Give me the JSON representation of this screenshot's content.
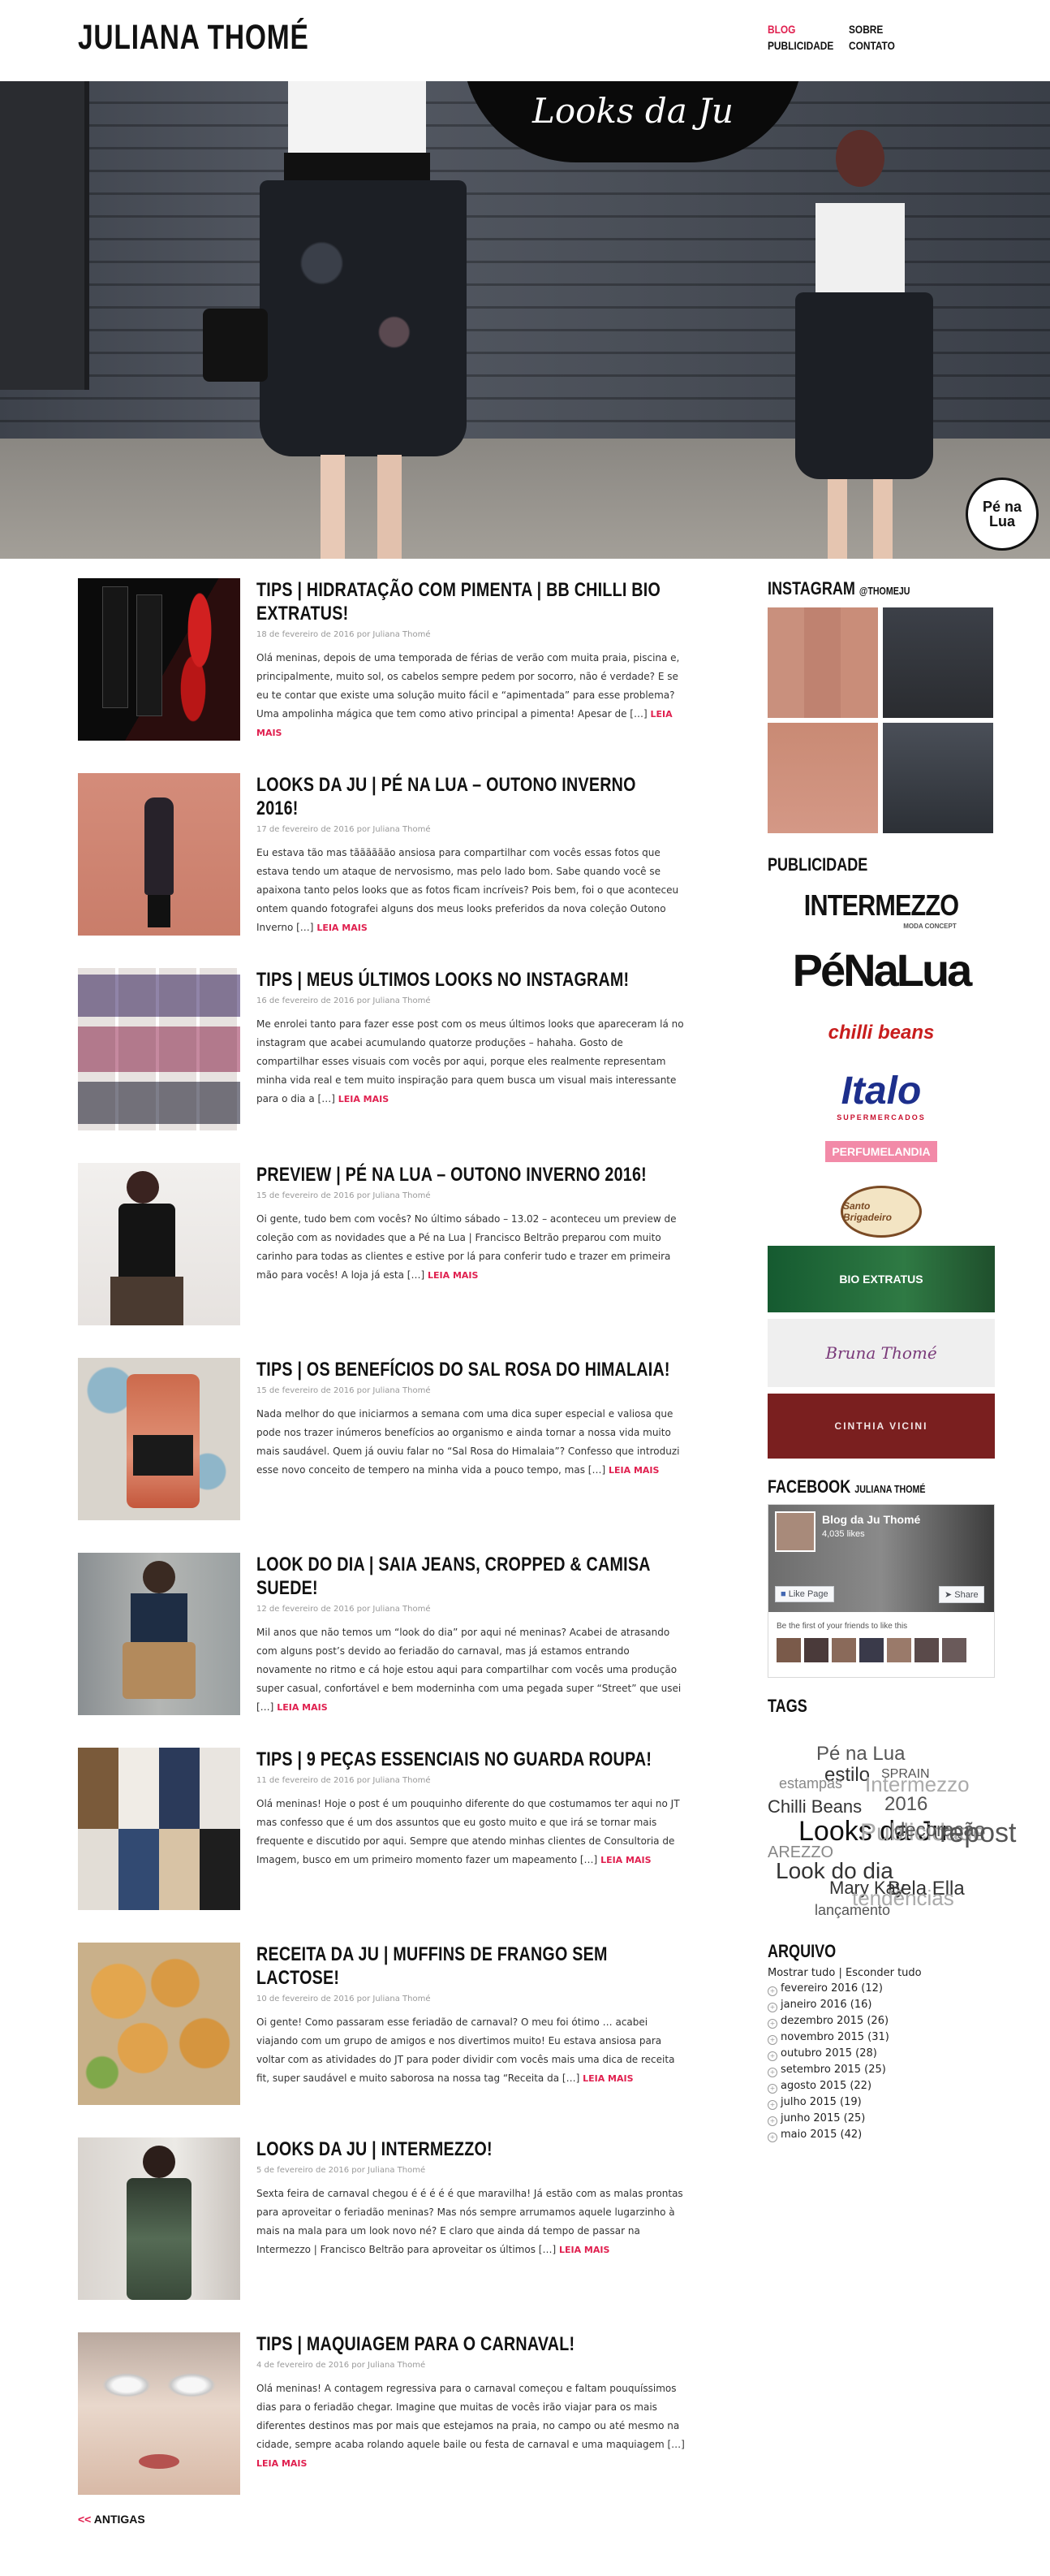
{
  "header": {
    "logo": "JULIANA THOMÉ",
    "nav": [
      "BLOG",
      "SOBRE",
      "PUBLICIDADE",
      "CONTATO"
    ]
  },
  "hero": {
    "badge": "Looks da Ju",
    "stamp": "Pé na Lua"
  },
  "posts": [
    {
      "title": "TIPS | HIDRATAÇÃO COM PIMENTA | BB CHILLI BIO EXTRATUS!",
      "date": "18 de fevereiro de 2016 por Juliana Thomé",
      "excerpt": "Olá meninas, depois de uma temporada de férias de verão com muita praia, piscina e, principalmente, muito sol, os cabelos sempre pedem por socorro, não é verdade? E se eu te contar que existe uma solução muito fácil e “apimentada” para esse problema? Uma ampolinha mágica que tem como ativo principal a pimenta! Apesar de […]",
      "read_more": "LEIA MAIS"
    },
    {
      "title": "LOOKS DA JU | PÉ NA LUA – OUTONO INVERNO 2016!",
      "date": "17 de fevereiro de 2016 por Juliana Thomé",
      "excerpt": "Eu estava tão mas tãããããão ansiosa para compartilhar com vocês essas fotos que estava tendo um ataque de nervosismo, mas pelo lado bom. Sabe quando você se apaixona tanto pelos looks que as fotos ficam incríveis? Pois bem, foi o que aconteceu ontem quando fotografei alguns dos meus looks preferidos da nova coleção Outono Inverno […]",
      "read_more": "LEIA MAIS"
    },
    {
      "title": "TIPS | MEUS ÚLTIMOS LOOKS NO INSTAGRAM!",
      "date": "16 de fevereiro de 2016 por Juliana Thomé",
      "excerpt": "Me enrolei tanto para fazer esse post com os meus últimos looks que apareceram lá no instagram que acabei acumulando quatorze produções – hahaha. Gosto de compartilhar esses visuais com vocês por aqui, porque eles realmente representam minha vida real e tem muito inspiração para quem busca um visual mais interessante para o dia a […]",
      "read_more": "LEIA MAIS"
    },
    {
      "title": "PREVIEW | PÉ NA LUA – OUTONO INVERNO 2016!",
      "date": "15 de fevereiro de 2016 por Juliana Thomé",
      "excerpt": "Oi gente, tudo bem com vocês? No último sábado – 13.02 – aconteceu um preview de coleção com as novidades que a Pé na Lua | Francisco Beltrão preparou com muito carinho para todas as clientes e estive por lá para conferir tudo e trazer em primeira mão para vocês! A loja já esta […]",
      "read_more": "LEIA MAIS"
    },
    {
      "title": "TIPS | OS BENEFÍCIOS DO SAL ROSA DO HIMALAIA!",
      "date": "15 de fevereiro de 2016 por Juliana Thomé",
      "excerpt": "Nada melhor do que iniciarmos a semana com uma dica super especial e valiosa que pode nos trazer inúmeros benefícios ao organismo e ainda tornar a nossa vida muito mais saudável. Quem já ouviu falar no “Sal Rosa do Himalaia”? Confesso que introduzi esse novo conceito de tempero na minha vida a pouco tempo, mas […]",
      "read_more": "LEIA MAIS"
    },
    {
      "title": "LOOK DO DIA | SAIA JEANS, CROPPED & CAMISA SUEDE!",
      "date": "12 de fevereiro de 2016 por Juliana Thomé",
      "excerpt": "Mil anos que não temos um “look do dia” por aqui né meninas? Acabei de atrasando com alguns post’s devido ao feriadão do carnaval, mas já estamos entrando novamente no ritmo e cá hoje estou aqui para compartilhar com vocês uma produção super casual, confortável e bem moderninha com uma pegada super “Street” que usei […]",
      "read_more": "LEIA MAIS"
    },
    {
      "title": "TIPS | 9 PEÇAS ESSENCIAIS NO GUARDA ROUPA!",
      "date": "11 de fevereiro de 2016 por Juliana Thomé",
      "excerpt": "Olá meninas! Hoje o post é um pouquinho diferente do que costumamos ter aqui no JT mas confesso que é um dos assuntos que eu gosto muito e que irá se tornar mais frequente e discutido por aqui. Sempre que atendo minhas clientes de Consultoria de Imagem, busco em um primeiro momento fazer um mapeamento […]",
      "read_more": "LEIA MAIS"
    },
    {
      "title": "RECEITA DA JU | MUFFINS DE FRANGO SEM LACTOSE!",
      "date": "10 de fevereiro de 2016 por Juliana Thomé",
      "excerpt": "Oi gente! Como passaram esse feriadão de carnaval? O meu foi ótimo … acabei viajando com um grupo de amigos e nos divertimos muito! Eu estava ansiosa para voltar com as atividades do JT para poder dividir com vocês mais uma dica de receita fit, super saudável e muito saborosa na nossa tag “Receita da […]",
      "read_more": "LEIA MAIS"
    },
    {
      "title": "LOOKS DA JU | INTERMEZZO!",
      "date": "5 de fevereiro de 2016 por Juliana Thomé",
      "excerpt": "Sexta feira de carnaval chegou é é é é é que maravilha! Já estão com as malas prontas para aproveitar o feriadão meninas? Mas nós sempre arrumamos aquele lugarzinho à mais na mala para um look novo né? E claro que ainda dá tempo de passar na Intermezzo | Francisco Beltrão para aproveitar os últimos […]",
      "read_more": "LEIA MAIS"
    },
    {
      "title": "TIPS | MAQUIAGEM PARA O CARNAVAL!",
      "date": "4 de fevereiro de 2016 por Juliana Thomé",
      "excerpt": "Olá meninas! A contagem regressiva para o carnaval começou e faltam pouquíssimos dias para o feriadão chegar. Imagine que muitas de vocês irão viajar para os mais diferentes destinos mas por mais que estejamos na praia, no campo ou até mesmo na cidade, sempre acaba rolando aquele baile ou festa de carnaval e uma maquiagem […]",
      "read_more": "LEIA MAIS"
    }
  ],
  "older_link": {
    "arrows": "<<",
    "label": "ANTIGAS"
  },
  "sidebar": {
    "instagram_title": "INSTAGRAM",
    "instagram_handle": "@THOMEJU",
    "publicidade_title": "PUBLICIDADE",
    "ads": [
      "INTERMEZZO",
      "MODA CONCEPT",
      "PéNaLua",
      "chilli beans",
      "Italo",
      "SUPERMERCADOS",
      "PERFUMELANDIA",
      "Santo Brigadeiro",
      "BIO EXTRATUS",
      "Bruna Thomé",
      "CINTHIA VICINI"
    ],
    "facebook_title": "FACEBOOK",
    "facebook_handle": "JULIANA THOMÉ",
    "facebook": {
      "page_name": "Blog da Ju Thomé",
      "likes": "4,035 likes",
      "like_button": "Like Page",
      "share_button": "Share",
      "friends_text": "Be the first of your friends to like this"
    },
    "tags_title": "TAGS",
    "tags": [
      "Pé na Lua",
      "estilo",
      "SPRAIN",
      "estampas",
      "Intermezzo",
      "2016",
      "Chilli Beans",
      "Looks da Ju",
      "Publicidade",
      "decoração",
      "repost",
      "AREZZO",
      "Look do dia",
      "Mary Kay",
      "Bela Ella",
      "tendências",
      "lançamento"
    ],
    "archive_title": "ARQUIVO",
    "archive_toggle": "Mostrar tudo | Esconder tudo",
    "archive": [
      "fevereiro 2016 (12)",
      "janeiro 2016 (16)",
      "dezembro 2015 (26)",
      "novembro 2015 (31)",
      "outubro 2015 (28)",
      "setembro 2015 (25)",
      "agosto 2015 (22)",
      "julho 2015 (19)",
      "junho 2015 (25)",
      "maio 2015 (42)"
    ]
  },
  "colors": {
    "accent": "#e0204f",
    "text": "#222222",
    "heading": "#111111"
  }
}
